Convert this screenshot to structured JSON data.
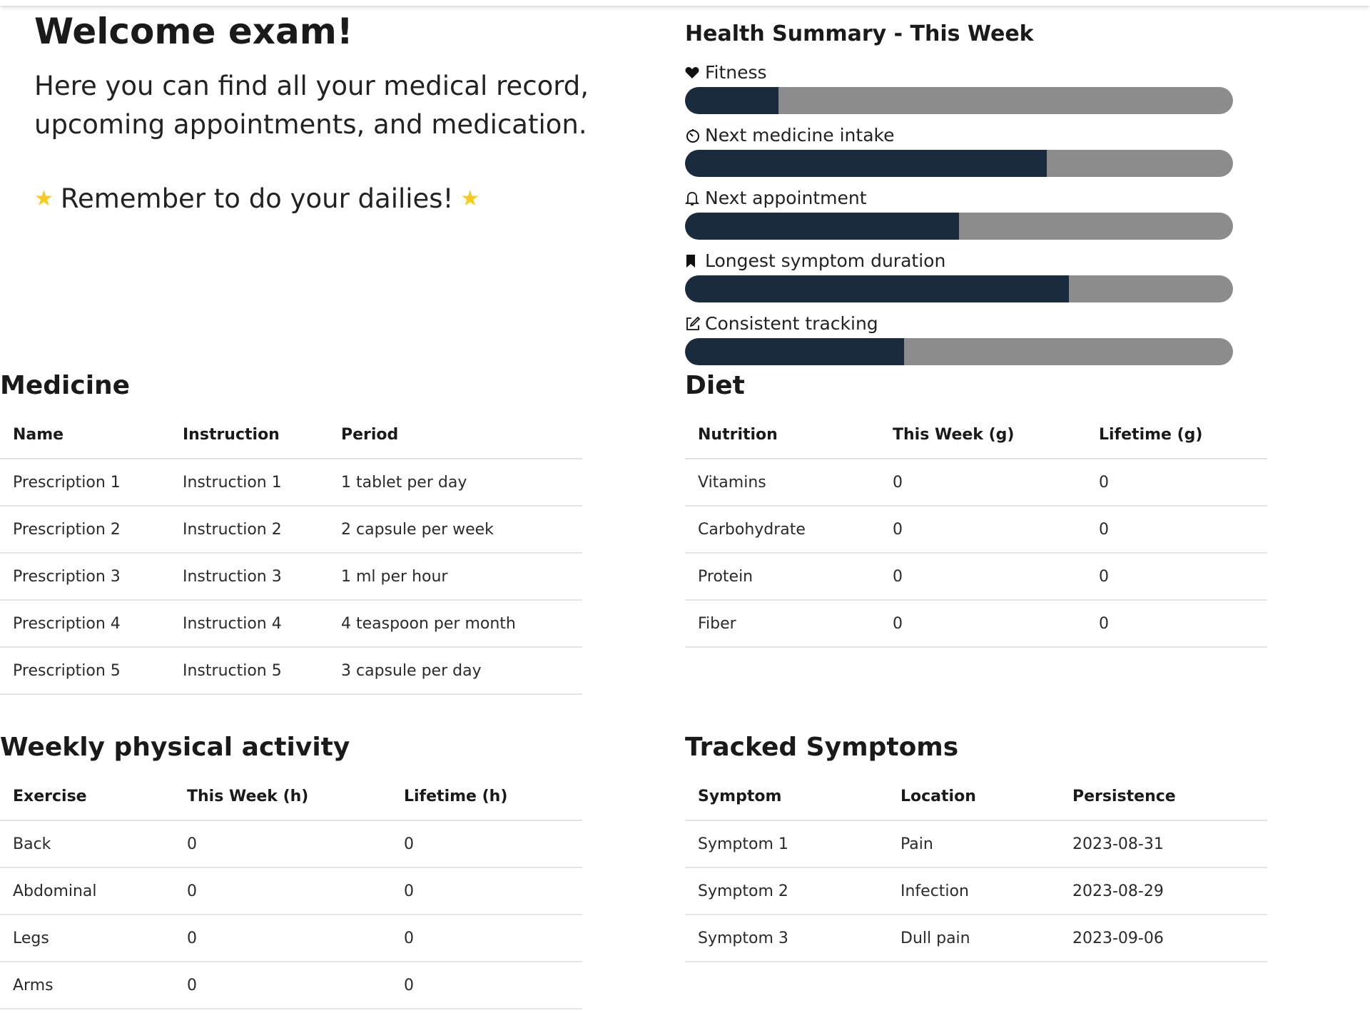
{
  "welcome": {
    "title": "Welcome exam!",
    "intro": "Here you can find all your medical record, upcoming appointments, and medication.",
    "reminder": "Remember to do your dailies!"
  },
  "health": {
    "title": "Health Summary - This Week",
    "metrics": [
      {
        "label": "Fitness",
        "icon": "heart-icon",
        "progress": 0.17
      },
      {
        "label": "Next medicine intake",
        "icon": "timer-icon",
        "progress": 0.66
      },
      {
        "label": "Next appointment",
        "icon": "bell-icon",
        "progress": 0.5
      },
      {
        "label": "Longest symptom duration",
        "icon": "bookmark-icon",
        "progress": 0.7
      },
      {
        "label": "Consistent tracking",
        "icon": "edit-icon",
        "progress": 0.4
      }
    ]
  },
  "colors": {
    "bar_fill": "#1b2b3e",
    "bar_track": "#8c8c8c",
    "star": "#f5cc1b"
  },
  "medicine": {
    "title": "Medicine",
    "headers": [
      "Name",
      "Instruction",
      "Period"
    ],
    "rows": [
      [
        "Prescription 1",
        "Instruction 1",
        "1 tablet per day"
      ],
      [
        "Prescription 2",
        "Instruction 2",
        "2 capsule per week"
      ],
      [
        "Prescription 3",
        "Instruction 3",
        "1 ml per hour"
      ],
      [
        "Prescription 4",
        "Instruction 4",
        "4 teaspoon per month"
      ],
      [
        "Prescription 5",
        "Instruction 5",
        "3 capsule per day"
      ]
    ]
  },
  "diet": {
    "title": "Diet",
    "headers": [
      "Nutrition",
      "This Week (g)",
      "Lifetime (g)"
    ],
    "rows": [
      [
        "Vitamins",
        "0",
        "0"
      ],
      [
        "Carbohydrate",
        "0",
        "0"
      ],
      [
        "Protein",
        "0",
        "0"
      ],
      [
        "Fiber",
        "0",
        "0"
      ]
    ]
  },
  "activity": {
    "title": "Weekly physical activity",
    "headers": [
      "Exercise",
      "This Week (h)",
      "Lifetime (h)"
    ],
    "rows": [
      [
        "Back",
        "0",
        "0"
      ],
      [
        "Abdominal",
        "0",
        "0"
      ],
      [
        "Legs",
        "0",
        "0"
      ],
      [
        "Arms",
        "0",
        "0"
      ]
    ]
  },
  "symptoms": {
    "title": "Tracked Symptoms",
    "headers": [
      "Symptom",
      "Location",
      "Persistence"
    ],
    "rows": [
      [
        "Symptom 1",
        "Pain",
        "2023-08-31"
      ],
      [
        "Symptom 2",
        "Infection",
        "2023-08-29"
      ],
      [
        "Symptom 3",
        "Dull pain",
        "2023-09-06"
      ]
    ]
  }
}
